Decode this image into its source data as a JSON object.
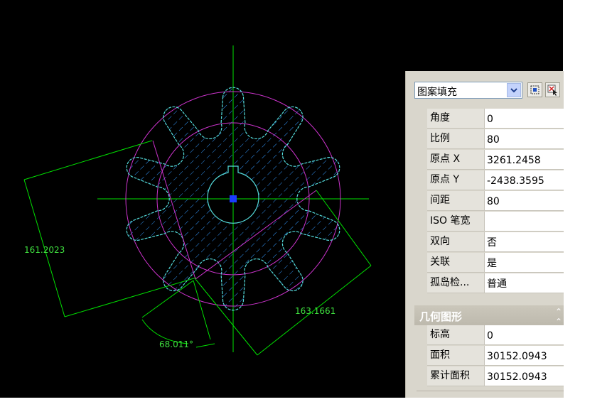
{
  "dimensions": {
    "dim1": "161.2023",
    "dim2": "163.1661",
    "angle": "68.011°"
  },
  "properties": {
    "object_type": "图案填充",
    "pattern": [
      {
        "label": "角度",
        "value": "0"
      },
      {
        "label": "比例",
        "value": "80"
      },
      {
        "label": "原点 X",
        "value": "3261.2458"
      },
      {
        "label": "原点 Y",
        "value": "-2438.3595"
      },
      {
        "label": "间距",
        "value": "80"
      },
      {
        "label": "ISO 笔宽",
        "value": ""
      },
      {
        "label": "双向",
        "value": "否"
      },
      {
        "label": "关联",
        "value": "是"
      },
      {
        "label": "孤岛检...",
        "value": "普通"
      }
    ],
    "geometry_title": "几何图形",
    "geometry": [
      {
        "label": "标高",
        "value": "0"
      },
      {
        "label": "面积",
        "value": "30152.0943"
      },
      {
        "label": "累计面积",
        "value": "30152.0943"
      }
    ]
  },
  "colors": {
    "background": "#000000",
    "centerline": "#00e000",
    "circle": "#cc33cc",
    "profile": "#55dddd",
    "hatch": "#3399ff",
    "grip": "#1a3cff"
  }
}
